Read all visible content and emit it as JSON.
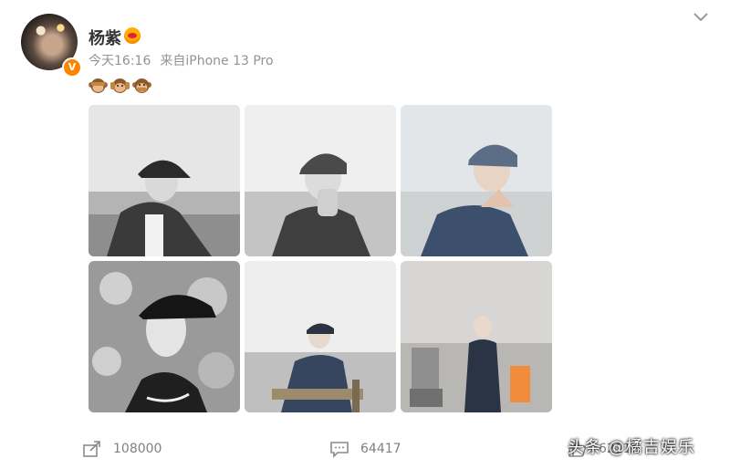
{
  "post": {
    "author_name": "杨紫",
    "verified_badge": "V",
    "time": "今天16:16",
    "source": "来自iPhone 13 Pro",
    "emojis": [
      "see-no-evil-monkey",
      "hear-no-evil-monkey",
      "speak-no-evil-monkey"
    ]
  },
  "photos": [
    {
      "name": "photo-1",
      "desc": "bw cap denim jacket side"
    },
    {
      "name": "photo-2",
      "desc": "bw cap hands on face"
    },
    {
      "name": "photo-3",
      "desc": "color denim hands clasped"
    },
    {
      "name": "photo-4",
      "desc": "bw profile cap wall"
    },
    {
      "name": "photo-5",
      "desc": "sitting director chair"
    },
    {
      "name": "photo-6",
      "desc": "sitting in room"
    }
  ],
  "actions": {
    "share_count": "108000",
    "comment_count": "64417",
    "like_count": "62116"
  },
  "watermark": "头条 @橘吉娱乐",
  "colors": {
    "accent": "#ff8200",
    "meta": "#939393",
    "background": "#ffffff"
  }
}
